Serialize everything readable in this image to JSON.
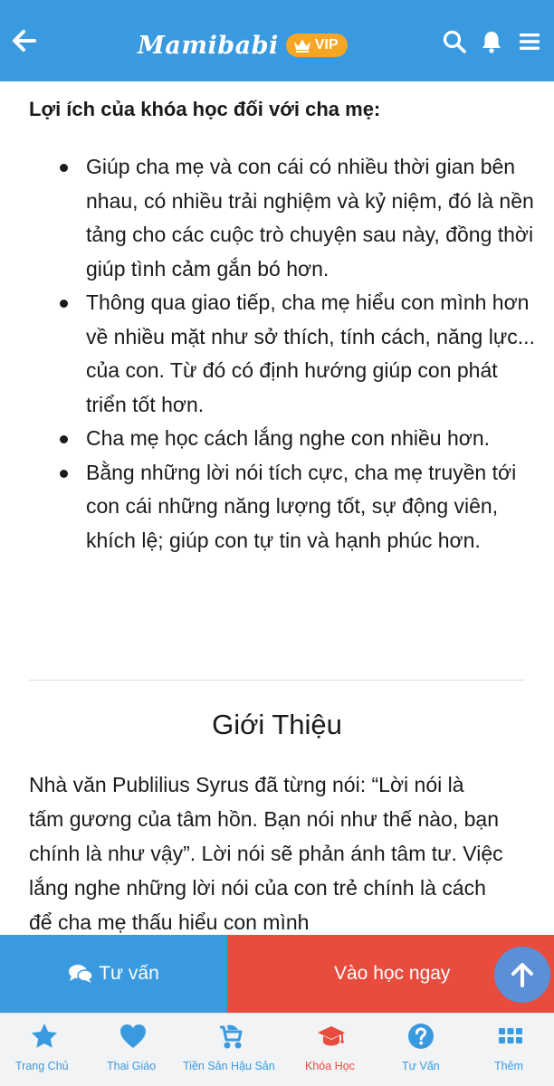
{
  "header": {
    "logo_text": "Mamibabi",
    "vip_label": "VIP",
    "icons": [
      "back-arrow-icon",
      "crown-icon",
      "search-icon",
      "bell-icon",
      "menu-icon"
    ]
  },
  "content": {
    "benefits_title": "Lợi ích của khóa học đối với cha mẹ:",
    "benefits": [
      "Giúp cha mẹ và con cái có nhiều thời gian bên nhau, có nhiều trải nghiệm và kỷ niệm, đó là nền tảng cho các cuộc trò chuyện sau này, đồng thời giúp tình cảm gắn bó hơn.",
      "Thông qua giao tiếp, cha mẹ hiểu con mình hơn về nhiều mặt như sở thích, tính cách, năng lực... của con. Từ đó có định hướng giúp con phát triển tốt hơn.",
      "Cha mẹ học cách lắng nghe con nhiều hơn.",
      "Bằng những lời nói tích cực, cha mẹ truyền tới con cái những năng lượng tốt, sự động viên, khích lệ; giúp con tự tin và hạnh phúc hơn."
    ],
    "section_title": "Giới Thiệu",
    "intro_text": "Nhà văn Publilius Syrus đã từng nói: “Lời nói là tấm gương của tâm hồn. Bạn nói như thế nào, bạn chính là như vậy”. Lời nói sẽ phản ánh tâm tư. Việc lắng nghe những lời nói của con trẻ chính là cách để cha mẹ thấu hiểu con mình"
  },
  "actions": {
    "consult_label": "Tư vấn",
    "learn_label": "Vào học ngay"
  },
  "bottom_nav": {
    "items": [
      {
        "label": "Trang Chủ",
        "icon": "star-icon"
      },
      {
        "label": "Thai Giáo",
        "icon": "heart-icon"
      },
      {
        "label": "Tiền Sản Hậu Sản",
        "icon": "stroller-icon"
      },
      {
        "label": "Khóa Học",
        "icon": "graduation-cap-icon",
        "active": true
      },
      {
        "label": "Tư Vấn",
        "icon": "question-icon"
      },
      {
        "label": "Thêm",
        "icon": "grid-icon"
      }
    ]
  },
  "colors": {
    "primary": "#3a9ae0",
    "accent": "#e84c3d",
    "vip": "#f5a623",
    "scroll_top": "#5b8fd6"
  }
}
